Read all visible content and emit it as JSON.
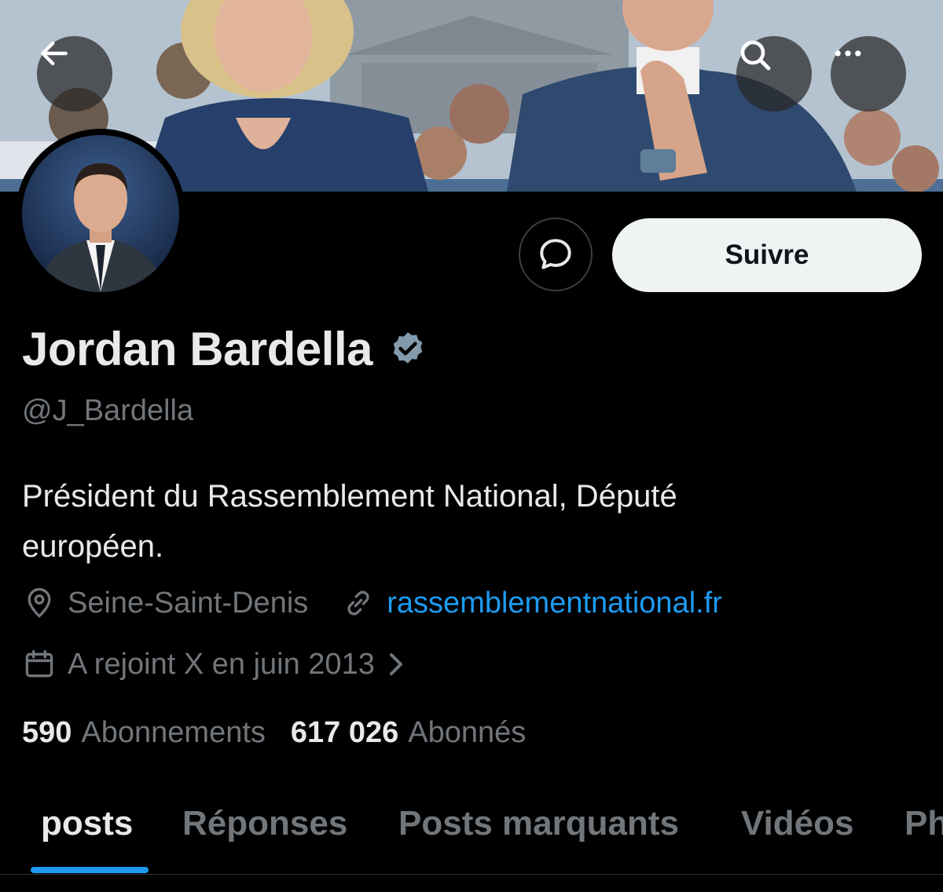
{
  "banner": {
    "back_icon": "arrow-left-icon",
    "search_icon": "search-icon",
    "more_icon": "more-horizontal-icon"
  },
  "actions": {
    "message_icon": "message-bubble-icon",
    "follow_label": "Suivre"
  },
  "profile": {
    "name": "Jordan Bardella",
    "verified_icon": "verified-badge-icon",
    "handle": "@J_Bardella",
    "bio_line1": "Président du Rassemblement National, Député",
    "bio_line2": "européen.",
    "location": "Seine-Saint-Denis",
    "website": "rassemblementnational.fr",
    "joined": "A rejoint X en juin 2013"
  },
  "stats": {
    "following_count": "590",
    "following_label": "Abonnements",
    "followers_count": "617 026",
    "followers_label": "Abonnés"
  },
  "tabs": [
    "posts",
    "Réponses",
    "Posts marquants",
    "Vidéos",
    "Ph"
  ],
  "colors": {
    "background": "#000000",
    "accent": "#1d9bf0",
    "text_primary": "#e7e9ea",
    "text_secondary": "#71767b",
    "follow_button_bg": "#eff3f4"
  }
}
